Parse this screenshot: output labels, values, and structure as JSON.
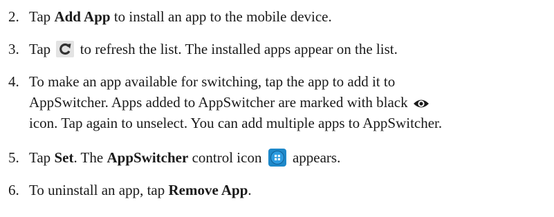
{
  "steps": [
    {
      "number": "2.",
      "text_before": "Tap ",
      "bold": "Add App",
      "text_after": " to install an app to the mobile device."
    },
    {
      "number": "3.",
      "text_before": "Tap ",
      "icon": "refresh-icon",
      "text_after": " to refresh the list. The installed apps appear on the list."
    },
    {
      "number": "4.",
      "line1": "To make an app available for switching, tap the app to add it to",
      "line2_before": "AppSwitcher. Apps added to AppSwitcher are marked with black ",
      "icon": "eye-icon",
      "line3": "icon. Tap again to unselect. You can add multiple apps to AppSwitcher."
    },
    {
      "number": "5.",
      "text_before": "Tap ",
      "bold1": "Set",
      "text_mid": ". The ",
      "bold2": "AppSwitcher",
      "text_mid2": " control icon ",
      "icon": "appswitcher-icon",
      "text_after": " appears."
    },
    {
      "number": "6.",
      "text_before": "To uninstall an app, tap ",
      "bold": "Remove App",
      "text_after": "."
    }
  ],
  "colors": {
    "text": "#1a1a1a",
    "refresh_icon_bg": "#e3e3e3",
    "appswitcher_icon_bg": "#1e88c9"
  }
}
